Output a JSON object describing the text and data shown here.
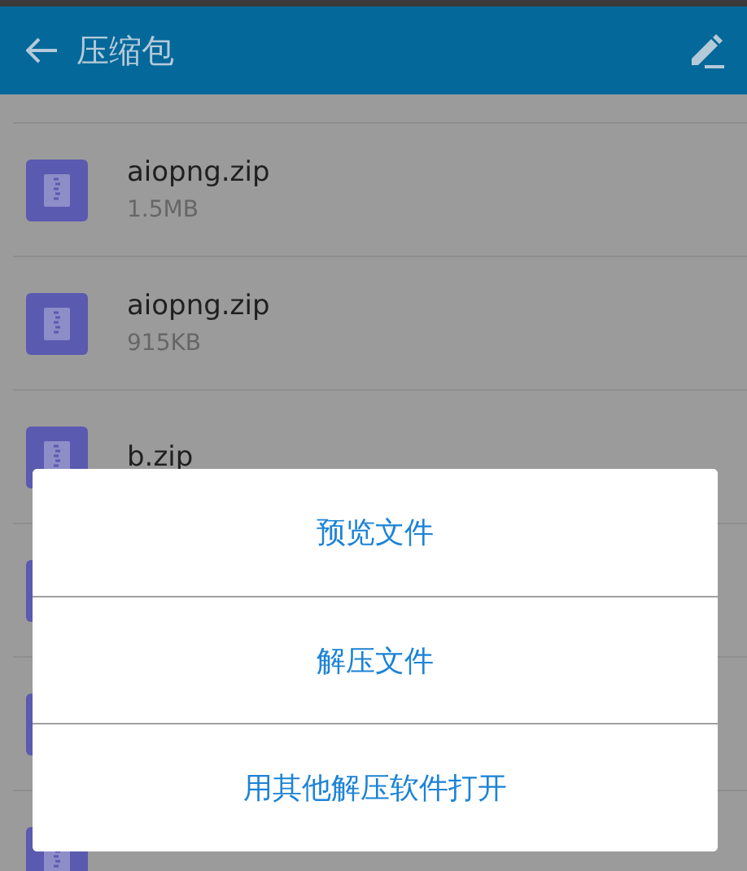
{
  "header": {
    "title": "压缩包"
  },
  "files": [
    {
      "kind": "file",
      "name": "aiopng.zip",
      "size": "1.5MB"
    },
    {
      "kind": "file",
      "name": "aiopng.zip",
      "size": "915KB"
    },
    {
      "kind": "file",
      "name": "b.zip"
    },
    {
      "kind": "covered"
    },
    {
      "kind": "covered"
    },
    {
      "kind": "covered"
    }
  ],
  "dialog": {
    "options": [
      "预览文件",
      "解压文件",
      "用其他解压软件打开"
    ]
  }
}
